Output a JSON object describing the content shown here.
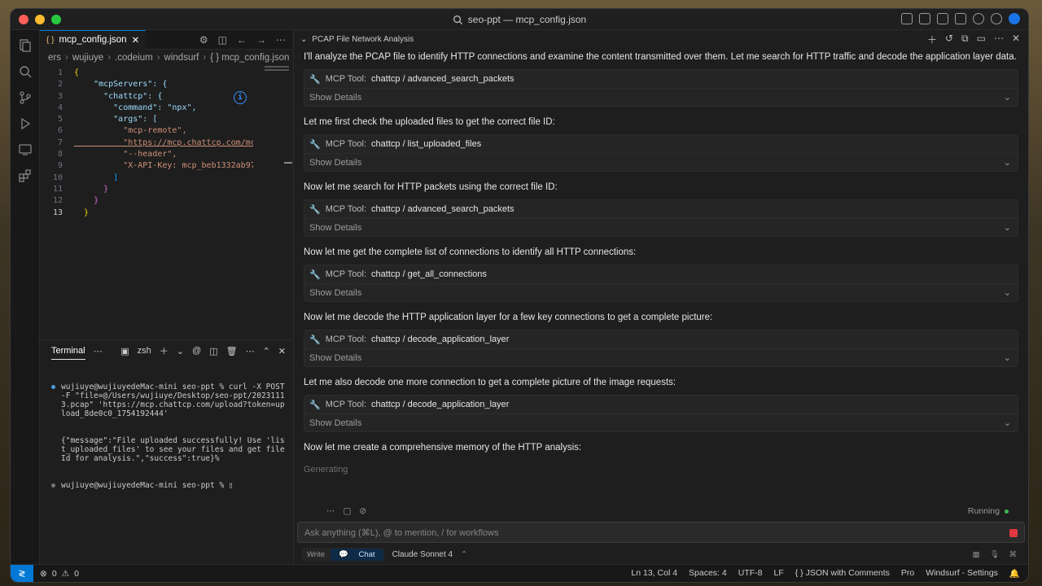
{
  "window": {
    "title": "seo-ppt — mcp_config.json"
  },
  "editor": {
    "tab_label": "mcp_config.json",
    "breadcrumb": [
      "ers",
      "wujiuye",
      ".codeium",
      "windsurf",
      "{ } mcp_config.json",
      "..."
    ],
    "lines": [
      {
        "n": "1",
        "t": "{"
      },
      {
        "n": "2",
        "t": "    \"mcpServers\": {"
      },
      {
        "n": "3",
        "t": "      \"chattcp\": {"
      },
      {
        "n": "4",
        "t": "        \"command\": \"npx\","
      },
      {
        "n": "5",
        "t": "        \"args\": ["
      },
      {
        "n": "6",
        "t": "          \"mcp-remote\","
      },
      {
        "n": "7",
        "t": "          \"https://mcp.chattcp.com/mc"
      },
      {
        "n": "8",
        "t": "          \"--header\","
      },
      {
        "n": "9",
        "t": "          \"X-API-Key: mcp_beb1332ab97"
      },
      {
        "n": "10",
        "t": "        ]"
      },
      {
        "n": "11",
        "t": "      }"
      },
      {
        "n": "12",
        "t": "    }"
      },
      {
        "n": "13",
        "t": "  }"
      }
    ]
  },
  "terminal": {
    "tab_label": "Terminal",
    "shell": "zsh",
    "lines": [
      "wujiuye@wujiuyedeMac-mini seo-ppt % curl -X POST -F \"file=@/Users/wujiuye/Desktop/seo-ppt/20231113.pcap\" 'https://mcp.chattcp.com/upload?token=upload_8de0c0_1754192444'",
      "{\"message\":\"File uploaded successfully! Use 'list_uploaded_files' to see your files and get fileId for analysis.\",\"success\":true}%",
      "wujiuye@wujiuyedeMac-mini seo-ppt % "
    ]
  },
  "chat": {
    "title": "PCAP File Network Analysis",
    "intro": "I'll analyze the PCAP file to identify HTTP connections and examine the content transmitted over them. Let me search for HTTP traffic and decode the application layer data.",
    "tool_prefix": "MCP Tool:",
    "show_details": "Show Details",
    "steps": [
      {
        "tool": "chattcp / advanced_search_packets",
        "after": "Let me first check the uploaded files to get the correct file ID:"
      },
      {
        "tool": "chattcp / list_uploaded_files",
        "after": "Now let me search for HTTP packets using the correct file ID:"
      },
      {
        "tool": "chattcp / advanced_search_packets",
        "after": "Now let me get the complete list of connections to identify all HTTP connections:"
      },
      {
        "tool": "chattcp / get_all_connections",
        "after": "Now let me decode the HTTP application layer for a few key connections to get a complete picture:"
      },
      {
        "tool": "chattcp / decode_application_layer",
        "after": "Let me also decode one more connection to get a complete picture of the image requests:"
      },
      {
        "tool": "chattcp / decode_application_layer",
        "after": "Now let me create a comprehensive memory of the HTTP analysis:"
      }
    ],
    "generating": "Generating",
    "running": "Running",
    "input_placeholder": "Ask anything (⌘L), @ to mention, / for workflows",
    "mode_write": "Write",
    "mode_chat": "Chat",
    "model": "Claude Sonnet 4"
  },
  "statusbar": {
    "errors": "0",
    "warnings": "0",
    "position": "Ln 13, Col 4",
    "spaces": "Spaces: 4",
    "encoding": "UTF-8",
    "eol": "LF",
    "language": "{ }  JSON with Comments",
    "plan": "Pro",
    "settings": "Windsurf - Settings"
  }
}
